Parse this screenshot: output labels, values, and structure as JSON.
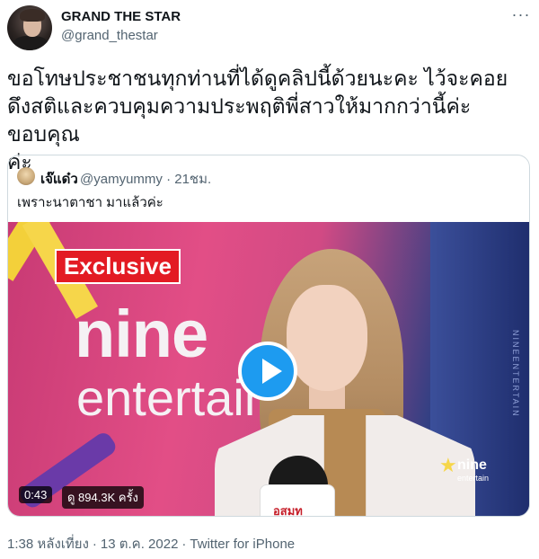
{
  "author": {
    "display_name": "GRAND THE STAR",
    "handle": "@grand_thestar",
    "avatar_icon": "profile-photo"
  },
  "more_icon": "···",
  "tweet_text": "ขอโทษประชาชนทุกท่านที่ได้ดูคลิปนี้ด้วยนะคะ ไว้จะคอย\nดึงสติและควบคุมความประพฤติพี่สาวให้มากกว่านี้ค่ะ ขอบคุณ\nค่ะ",
  "quote": {
    "name": "เจ๊แด๋ว",
    "handle_time": "@yamyummy · 21ชม.",
    "text": "เพราะนาตาชา มาแล้วค่ะ",
    "media": {
      "badge": "Exclusive",
      "brand_line1": "nine",
      "brand_line2": "entertain",
      "wall_text": "NINEENTERTAIN",
      "mic_label": "อสมท",
      "watermark_line1": "nine",
      "watermark_line2": "entertain",
      "duration": "0:43",
      "views": "ดู 894.3K ครั้ง",
      "play_icon": "play-icon"
    }
  },
  "meta": {
    "time": "1:38 หลังเที่ยง",
    "separator": "·",
    "date": "13 ต.ค. 2022",
    "source": "Twitter for iPhone"
  },
  "colors": {
    "accent": "#1d9bf0",
    "text": "#0f1419",
    "secondary": "#536471",
    "border": "#cfd9de",
    "badge_red": "#e31b23"
  }
}
